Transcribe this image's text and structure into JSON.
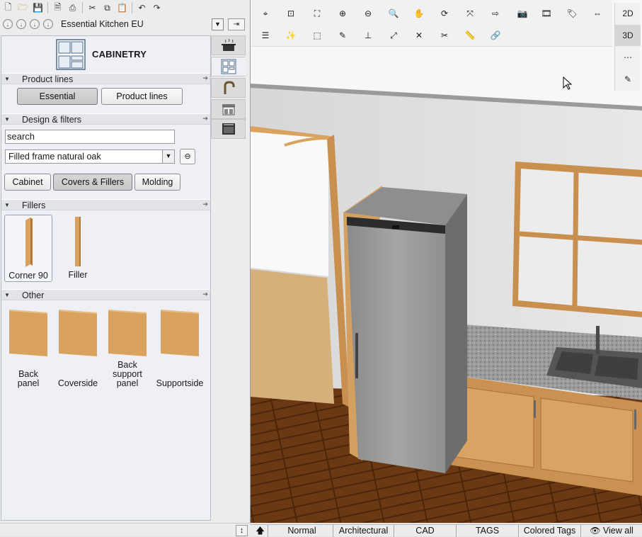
{
  "catalog": {
    "name": "Essential Kitchen EU"
  },
  "panel": {
    "title": "CABINETRY",
    "sections": {
      "product_lines": "Product lines",
      "design": "Design & filters",
      "fillers": "Fillers",
      "other": "Other"
    },
    "product_buttons": [
      "Essential",
      "Product lines"
    ],
    "search_value": "search",
    "frame_value": "Filled frame natural oak",
    "category_buttons": [
      "Cabinet",
      "Covers & Fillers",
      "Molding"
    ],
    "fillers": [
      "Corner 90",
      "Filler"
    ],
    "other": [
      {
        "line1": "Back",
        "line2": "panel",
        "line3": ""
      },
      {
        "line1": "Coverside",
        "line2": "",
        "line3": ""
      },
      {
        "line1": "Back",
        "line2": "support",
        "line3": "panel"
      },
      {
        "line1": "Supportside",
        "line2": "",
        "line3": ""
      }
    ]
  },
  "modes": [
    "2D",
    "3D"
  ],
  "status_bar": [
    "Normal",
    "Architectural",
    "CAD",
    "TAGS",
    "Colored Tags",
    "View all"
  ],
  "colors": {
    "panel_bg": "#eef0f5",
    "wood": "#d9a35f",
    "wall": "#dedede",
    "floor": "#6b3b16"
  }
}
